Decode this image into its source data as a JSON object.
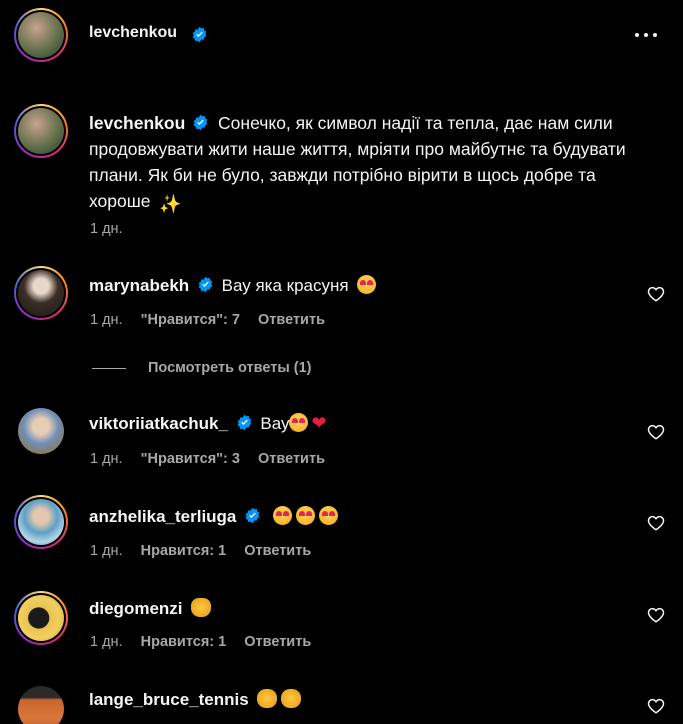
{
  "post": {
    "author": "levchenkou",
    "caption": "Сонечко, як символ надії та тепла, дає нам сили продовжувати жити наше життя, мріяти про майбутнє та будувати плани. Як би не було, завжди потрібно вірити в щось добре та хороше",
    "time": "1 дн."
  },
  "comments": [
    {
      "user": "marynabekh",
      "text": "Вау яка красуня",
      "time": "1 дн.",
      "likes": "\"Нравится\": 7",
      "reply": "Ответить"
    },
    {
      "user": "viktoriiatkachuk_",
      "text": "Вау",
      "time": "1 дн.",
      "likes": "\"Нравится\": 3",
      "reply": "Ответить"
    },
    {
      "user": "anzhelika_terliuga",
      "text": "",
      "time": "1 дн.",
      "likes": "Нравится: 1",
      "reply": "Ответить"
    },
    {
      "user": "diegomenzi",
      "text": "",
      "time": "1 дн.",
      "likes": "Нравится: 1",
      "reply": "Ответить"
    },
    {
      "user": "lange_bruce_tennis",
      "text": ""
    }
  ],
  "view_replies": "Посмотреть ответы (1)",
  "colors": {
    "bg": "#000000",
    "text": "#f5f5f5",
    "muted": "#a8a8a8",
    "verified": "#0095f6"
  }
}
